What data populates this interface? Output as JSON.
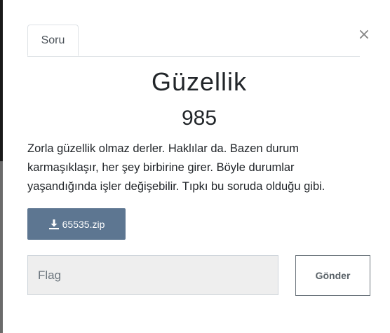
{
  "modal": {
    "close_symbol": "×",
    "tabs": [
      {
        "label": "Soru",
        "active": true
      }
    ]
  },
  "challenge": {
    "name": "Güzellik",
    "points": "985",
    "description": "Zorla güzellik olmaz derler. Haklılar da. Bazen durum karmaşıklaşır, her şey birbirine girer. Böyle durumlar yaşandığında işler değişebilir. Tıpkı bu soruda olduğu gibi.",
    "file_label": "65535.zip",
    "file_icon": "download-icon"
  },
  "form": {
    "flag_placeholder": "Flag",
    "flag_value": "",
    "submit_label": "Gönder"
  },
  "colors": {
    "download_button": "#5d7691",
    "input_background": "#eeeeee",
    "submit_border": "#6c757d"
  }
}
